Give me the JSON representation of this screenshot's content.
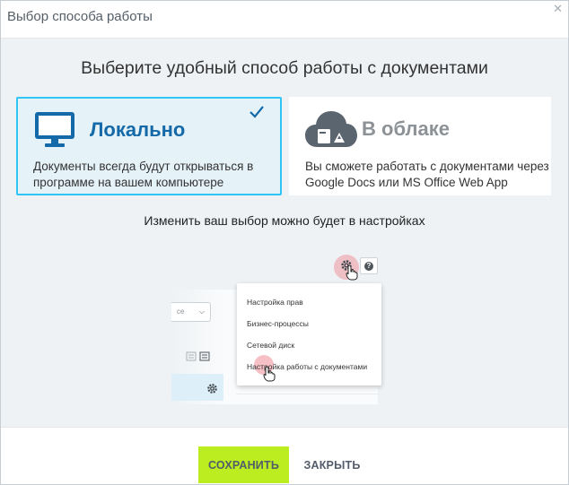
{
  "dialog": {
    "title": "Выбор способа работы",
    "close_icon": "close-icon"
  },
  "heading": "Выберите удобный способ работы с документами",
  "options": {
    "local": {
      "title": "Локально",
      "description": "Документы всегда будут открываться в программе на вашем компьютере",
      "icon": "monitor-icon",
      "selected": true
    },
    "cloud": {
      "title": "В облаке",
      "description": "Вы сможете работать с документами через Google Docs или MS Office Web App",
      "icon": "cloud-drive-icon",
      "selected": false
    }
  },
  "hint": "Изменить ваш выбор можно будет в настройках",
  "illustration": {
    "select_value": "се",
    "menu_items": [
      "Настройка прав",
      "Бизнес-процессы",
      "Сетевой диск",
      "Настройка работы с документами"
    ]
  },
  "footer": {
    "save_label": "СОХРАНИТЬ",
    "close_label": "ЗАКРЫТЬ"
  },
  "colors": {
    "accent": "#2fc6f6",
    "selected_bg": "#e5f2f8",
    "local_title": "#1469a8",
    "save_button": "#bbed21"
  }
}
